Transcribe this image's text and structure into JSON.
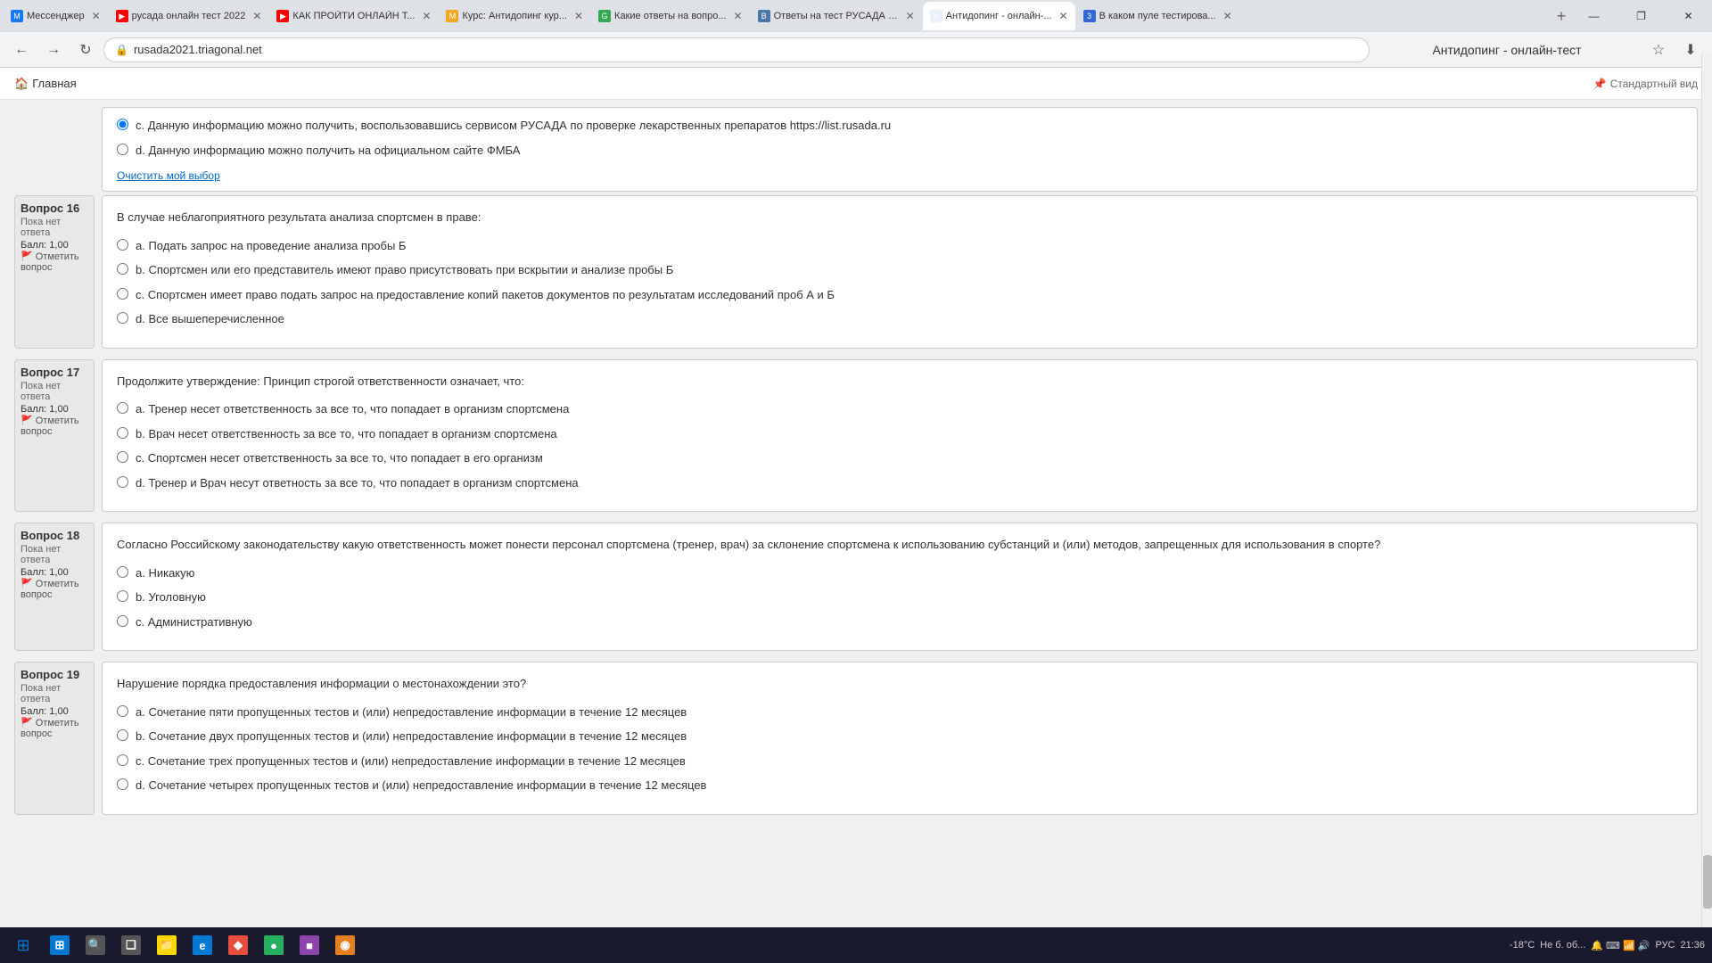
{
  "browser": {
    "tabs": [
      {
        "id": 1,
        "title": "Мессенджер",
        "favicon_color": "#1877f2",
        "favicon_text": "M",
        "active": false
      },
      {
        "id": 2,
        "title": "русада онлайн тест 2022",
        "favicon_color": "#ff0000",
        "favicon_text": "▶",
        "active": false
      },
      {
        "id": 3,
        "title": "КАК ПРОЙТИ ОНЛАЙН Т...",
        "favicon_color": "#ff0000",
        "favicon_text": "▶",
        "active": false
      },
      {
        "id": 4,
        "title": "Курс: Антидопинг кур...",
        "favicon_color": "#f5a623",
        "favicon_text": "M",
        "active": false
      },
      {
        "id": 5,
        "title": "Какие ответы на вопро...",
        "favicon_color": "#34a853",
        "favicon_text": "G",
        "active": false
      },
      {
        "id": 6,
        "title": "Ответы на тест РУСАДА 2...",
        "favicon_color": "#4a76a8",
        "favicon_text": "В",
        "active": false
      },
      {
        "id": 7,
        "title": "Антидопинг - онлайн-...",
        "favicon_color": "#e8f0fe",
        "favicon_text": "A",
        "active": true
      },
      {
        "id": 8,
        "title": "В каком пуле тестирова...",
        "favicon_color": "#3367d6",
        "favicon_text": "3",
        "active": false
      }
    ],
    "address": "rusada2021.triagonal.net",
    "page_title": "Антидопинг - онлайн-тест"
  },
  "header": {
    "home_label": "Главная",
    "std_view_label": "Стандартный вид"
  },
  "partial_question": {
    "options": [
      {
        "id": "opt_c_prev",
        "text": "с. Данную информацию можно получить, воспользовавшись сервисом РУСАДА по проверке лекарственных препаратов https://list.rusada.ru",
        "selected": true
      },
      {
        "id": "opt_d_prev",
        "text": "d. Данную информацию можно получить на официальном сайте ФМБА",
        "selected": false
      }
    ],
    "clear_label": "Очистить мой выбор"
  },
  "questions": [
    {
      "num": "16",
      "label": "Вопрос",
      "status": "Пока нет ответа",
      "score_label": "Балл: 1,00",
      "flag_label": "Отметить вопрос",
      "text": "В случае неблагоприятного результата анализа спортсмен в праве:",
      "options": [
        {
          "id": "q16a",
          "text": "а. Подать запрос на проведение анализа пробы Б",
          "selected": false
        },
        {
          "id": "q16b",
          "text": "b. Спортсмен или его представитель имеют право присутствовать при вскрытии и анализе пробы Б",
          "selected": false
        },
        {
          "id": "q16c",
          "text": "с. Спортсмен имеет право подать запрос на предоставление копий пакетов документов по результатам исследований проб А и Б",
          "selected": false
        },
        {
          "id": "q16d",
          "text": "d. Все вышеперечисленное",
          "selected": false
        }
      ]
    },
    {
      "num": "17",
      "label": "Вопрос",
      "status": "Пока нет ответа",
      "score_label": "Балл: 1,00",
      "flag_label": "Отметить вопрос",
      "text": "Продолжите утверждение: Принцип строгой ответственности означает, что:",
      "options": [
        {
          "id": "q17a",
          "text": "а. Тренер несет ответственность за все то, что попадает в организм спортсмена",
          "selected": false
        },
        {
          "id": "q17b",
          "text": "b. Врач несет ответственность за все то, что попадает в организм спортсмена",
          "selected": false
        },
        {
          "id": "q17c",
          "text": "с. Спортсмен несет ответственность за все то, что попадает в его организм",
          "selected": false
        },
        {
          "id": "q17d",
          "text": "d. Тренер и Врач несут ответность за все то, что попадает в организм спортсмена",
          "selected": false
        }
      ]
    },
    {
      "num": "18",
      "label": "Вопрос",
      "status": "Пока нет ответа",
      "score_label": "Балл: 1,00",
      "flag_label": "Отметить вопрос",
      "text": "Согласно Российскому законодательству какую ответственность может понести персонал спортсмена (тренер, врач) за склонение спортсмена к использованию субстанций и (или) методов, запрещенных для использования в спорте?",
      "options": [
        {
          "id": "q18a",
          "text": "а. Никакую",
          "selected": false
        },
        {
          "id": "q18b",
          "text": "b. Уголовную",
          "selected": false
        },
        {
          "id": "q18c",
          "text": "с. Административную",
          "selected": false
        }
      ]
    },
    {
      "num": "19",
      "label": "Вопрос",
      "status": "Пока нет ответа",
      "score_label": "Балл: 1,00",
      "flag_label": "Отметить вопрос",
      "text": "Нарушение порядка предоставления информации о местонахождении это?",
      "options": [
        {
          "id": "q19a",
          "text": "а. Сочетание пяти пропущенных тестов и (или) непредоставление информации в течение 12 месяцев",
          "selected": false
        },
        {
          "id": "q19b",
          "text": "b. Сочетание двух пропущенных тестов и (или) непредоставление информации в течение 12 месяцев",
          "selected": false
        },
        {
          "id": "q19c",
          "text": "с. Сочетание трех пропущенных тестов и (или) непредоставление информации в течение 12 месяцев",
          "selected": false
        },
        {
          "id": "q19d",
          "text": "d. Сочетание четырех пропущенных тестов и (или) непредоставление информации в течение 12 месяцев",
          "selected": false
        }
      ]
    }
  ],
  "taskbar": {
    "apps": [
      {
        "name": "windows",
        "icon": "⊞",
        "color": "#0078d4"
      },
      {
        "name": "search",
        "icon": "🔍",
        "color": "#555"
      },
      {
        "name": "task-view",
        "icon": "❑",
        "color": "#555"
      },
      {
        "name": "file-explorer",
        "icon": "📁",
        "color": "#ffd700"
      },
      {
        "name": "edge",
        "icon": "e",
        "color": "#0078d4"
      },
      {
        "name": "app1",
        "icon": "◆",
        "color": "#e74c3c"
      },
      {
        "name": "app2",
        "icon": "●",
        "color": "#27ae60"
      },
      {
        "name": "app3",
        "icon": "■",
        "color": "#8e44ad"
      },
      {
        "name": "app4",
        "icon": "◉",
        "color": "#e67e22"
      }
    ],
    "system": {
      "temp": "-18°С",
      "weather": "Не б. об...",
      "time": "21:36",
      "lang": "РУС"
    }
  }
}
